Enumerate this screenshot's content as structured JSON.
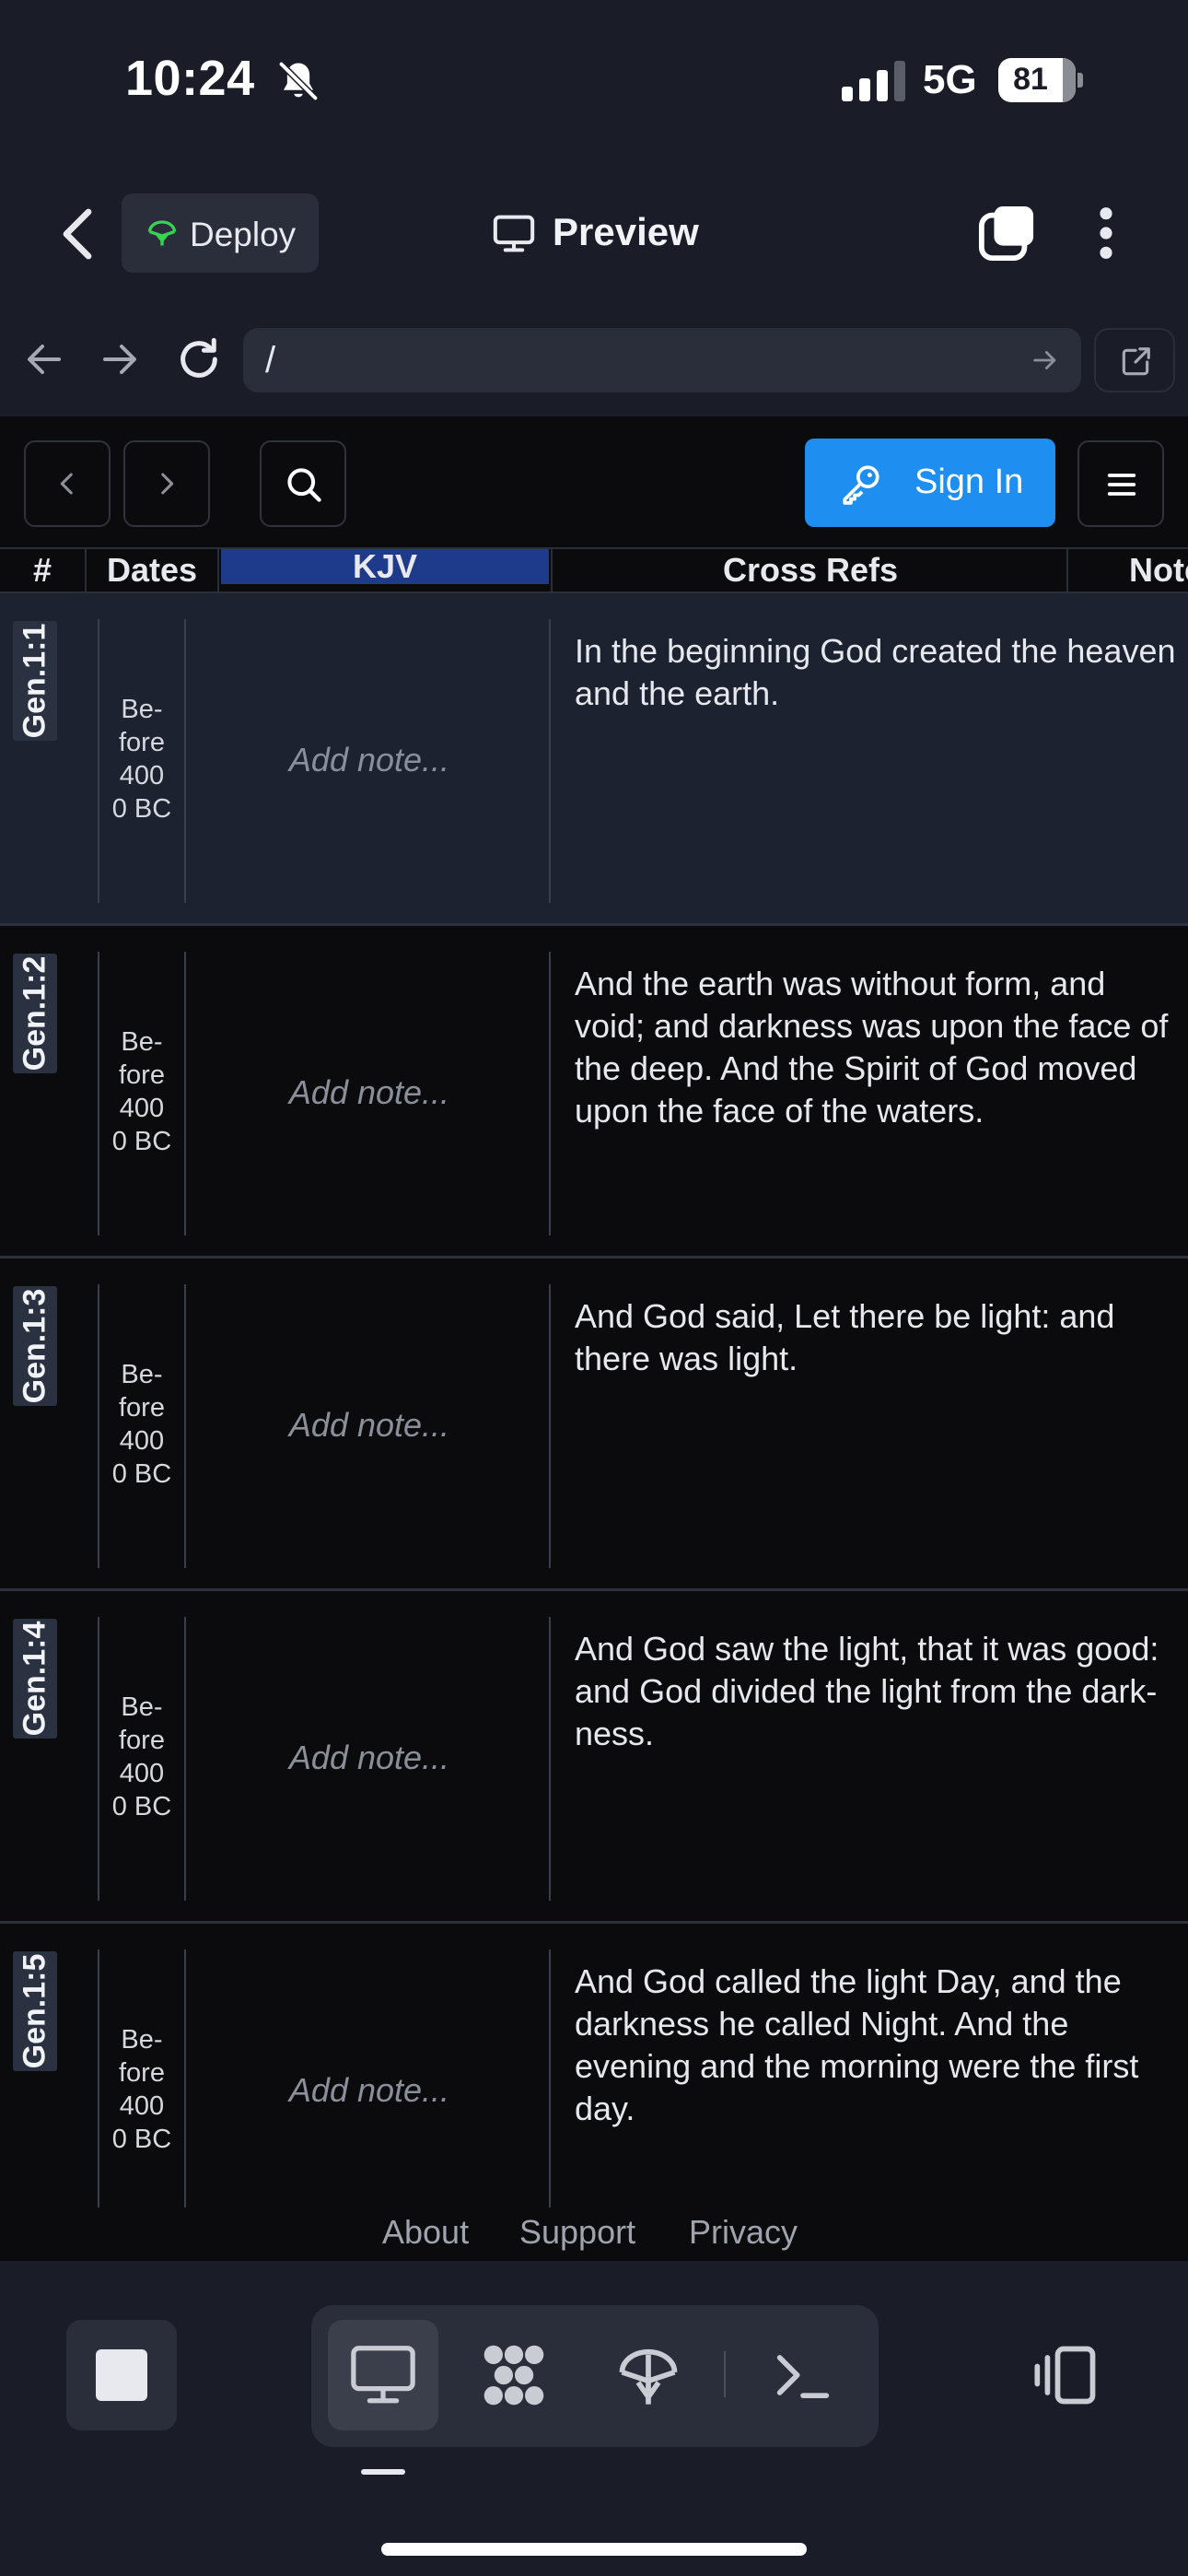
{
  "status_bar": {
    "time": "10:24",
    "network": "5G",
    "battery": "81"
  },
  "app_header": {
    "deploy_label": "Deploy",
    "preview_label": "Preview"
  },
  "browser": {
    "url": "/"
  },
  "toolbar": {
    "sign_in_label": "Sign In"
  },
  "table": {
    "headers": [
      "#",
      "Dates",
      "KJV",
      "Cross Refs",
      "Notes"
    ],
    "note_placeholder": "Add note...",
    "rows": [
      {
        "ref": "Gen.1:1",
        "date_lines": [
          "Be-",
          "fore",
          "400",
          "0 BC"
        ],
        "verse_lines": [
          "In the beginning God created the heaven",
          "and the earth."
        ]
      },
      {
        "ref": "Gen.1:2",
        "date_lines": [
          "Be-",
          "fore",
          "400",
          "0 BC"
        ],
        "verse_lines": [
          "And the earth was without form, and",
          "void; and darkness was upon the face of",
          "the deep. And the Spirit of God moved",
          "upon the face of the waters."
        ]
      },
      {
        "ref": "Gen.1:3",
        "date_lines": [
          "Be-",
          "fore",
          "400",
          "0 BC"
        ],
        "verse_lines": [
          "And God said, Let there be light: and",
          "there was light."
        ]
      },
      {
        "ref": "Gen.1:4",
        "date_lines": [
          "Be-",
          "fore",
          "400",
          "0 BC"
        ],
        "verse_lines": [
          "And God saw the light, that it was good:",
          "and God divided the light from the dark-",
          "ness."
        ]
      },
      {
        "ref": "Gen.1:5",
        "date_lines": [
          "Be-",
          "fore",
          "400",
          "0 BC"
        ],
        "verse_lines": [
          "And God called the light Day, and the",
          "darkness he called Night. And the",
          "evening and the morning were the first",
          "day."
        ]
      }
    ]
  },
  "footer": {
    "links": [
      "About",
      "Support",
      "Privacy"
    ]
  },
  "icons": {
    "status": [
      "bell-slash-icon",
      "cellular-signal-icon",
      "battery-icon"
    ],
    "header": [
      "chevron-left-icon",
      "deploy-icon",
      "monitor-icon",
      "tabs-icon",
      "more-vertical-icon"
    ],
    "browser": [
      "arrow-left-icon",
      "arrow-right-icon",
      "reload-icon",
      "arrow-go-icon",
      "external-link-icon"
    ],
    "toolbar": [
      "chevron-left-icon",
      "chevron-right-icon",
      "search-icon",
      "key-icon",
      "hamburger-menu-icon"
    ],
    "bottom": [
      "stop-icon",
      "desktop-icon",
      "workflows-icon",
      "deployments-icon",
      "terminal-icon",
      "pane-toggle-icon"
    ]
  },
  "colors": {
    "chrome_bg": "#1a1d27",
    "page_bg": "#0b0b0d",
    "selected_row_bg": "#1c2230",
    "accent_blue": "#1f8ef1",
    "kjv_header_bg": "#1e3a8a"
  }
}
